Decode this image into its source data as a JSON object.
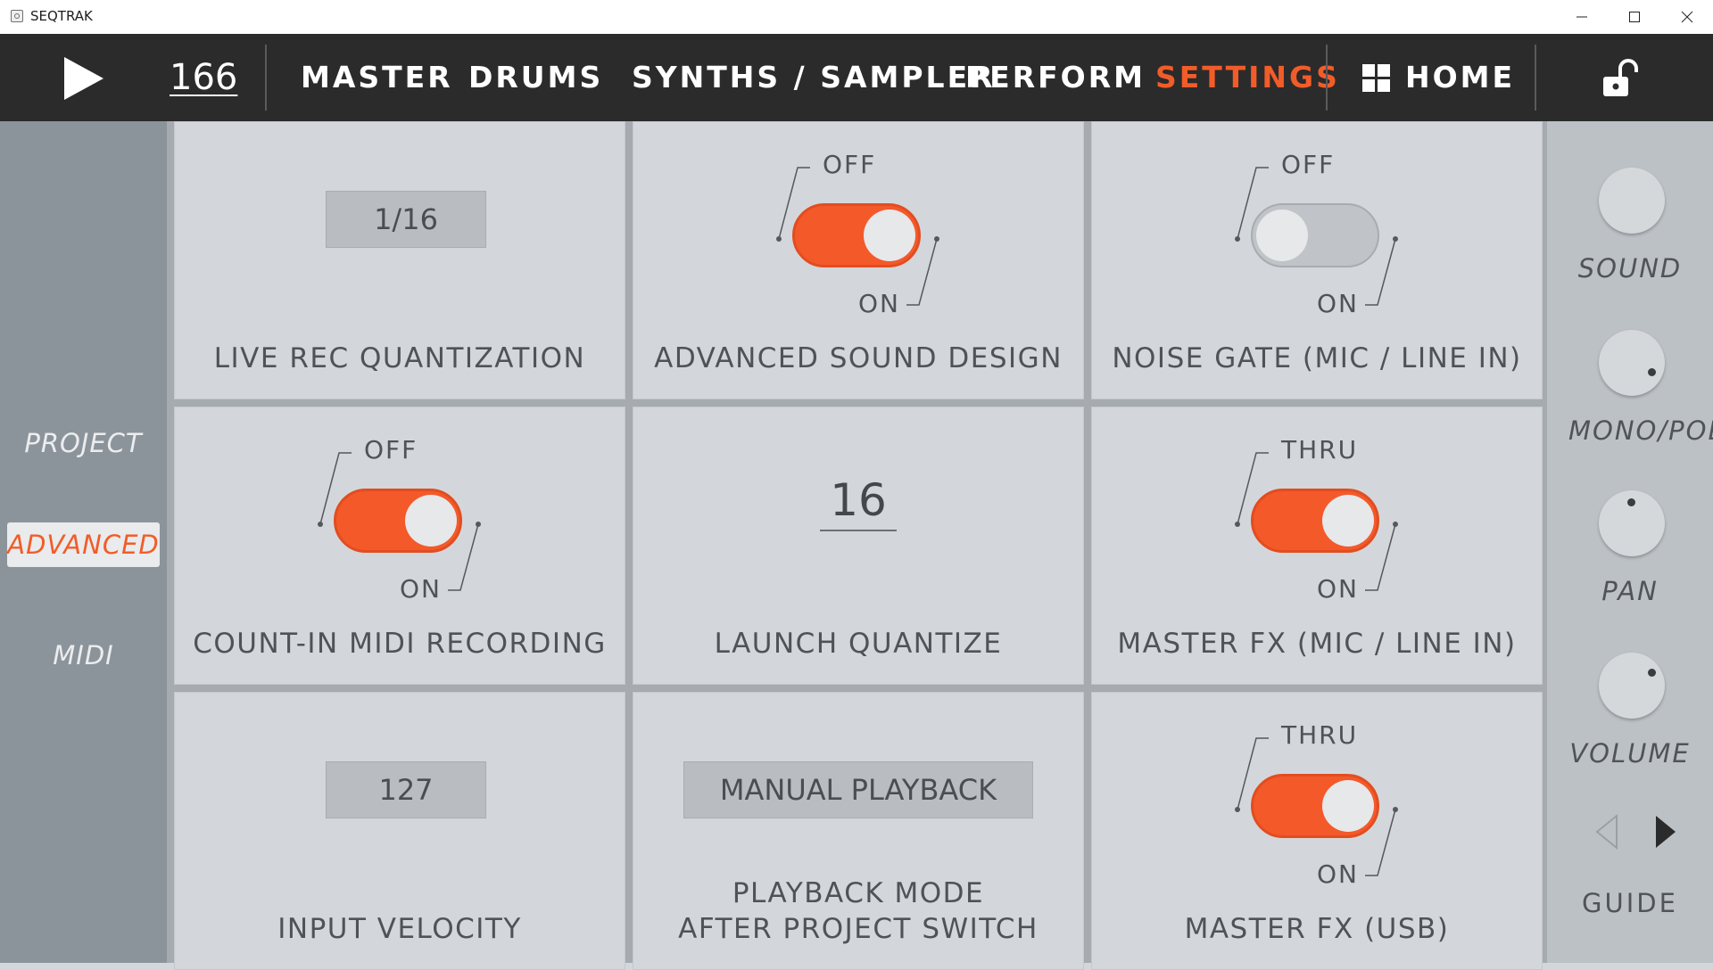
{
  "window": {
    "title": "SEQTRAK"
  },
  "topnav": {
    "tempo": "166",
    "tabs": {
      "master": "MASTER",
      "drums": "DRUMS",
      "synths": "SYNTHS / SAMPLER",
      "perform": "PERFORM",
      "settings": "SETTINGS"
    },
    "active_tab": "SETTINGS",
    "home": "HOME"
  },
  "sidebar": {
    "items": [
      {
        "label": "PROJECT"
      },
      {
        "label": "ADVANCED"
      },
      {
        "label": "MIDI"
      }
    ],
    "active": "ADVANCED"
  },
  "settings": {
    "live_rec_quantization": {
      "label": "LIVE REC QUANTIZATION",
      "value": "1/16"
    },
    "advanced_sound_design": {
      "label": "ADVANCED SOUND DESIGN",
      "off_label": "OFF",
      "on_label": "ON",
      "state": "ON"
    },
    "noise_gate": {
      "label": "NOISE GATE (MIC / LINE IN)",
      "off_label": "OFF",
      "on_label": "ON",
      "state": "OFF"
    },
    "count_in_midi": {
      "label": "COUNT-IN MIDI RECORDING",
      "off_label": "OFF",
      "on_label": "ON",
      "state": "ON"
    },
    "launch_quantize": {
      "label": "LAUNCH QUANTIZE",
      "value": "16"
    },
    "master_fx_mic": {
      "label": "MASTER FX (MIC / LINE IN)",
      "off_label": "THRU",
      "on_label": "ON",
      "state": "ON"
    },
    "input_velocity": {
      "label": "INPUT VELOCITY",
      "value": "127"
    },
    "playback_mode": {
      "label": "PLAYBACK MODE\nAFTER PROJECT SWITCH",
      "value": "MANUAL PLAYBACK"
    },
    "master_fx_usb": {
      "label": "MASTER FX (USB)",
      "off_label": "THRU",
      "on_label": "ON",
      "state": "ON"
    }
  },
  "rightpanel": {
    "knobs": [
      {
        "label": "SOUND"
      },
      {
        "label": "MONO/POLY"
      },
      {
        "label": "PAN"
      },
      {
        "label": "VOLUME"
      }
    ],
    "guide": "GUIDE"
  },
  "colors": {
    "accent": "#f25c29",
    "nav_bg": "#2b2b2b",
    "sidebar_bg": "#8c949b",
    "cell_bg": "#d3d7db"
  },
  "icons": [
    "play-icon",
    "home-icon",
    "unlock-icon",
    "arrow-left-icon",
    "arrow-right-icon"
  ]
}
